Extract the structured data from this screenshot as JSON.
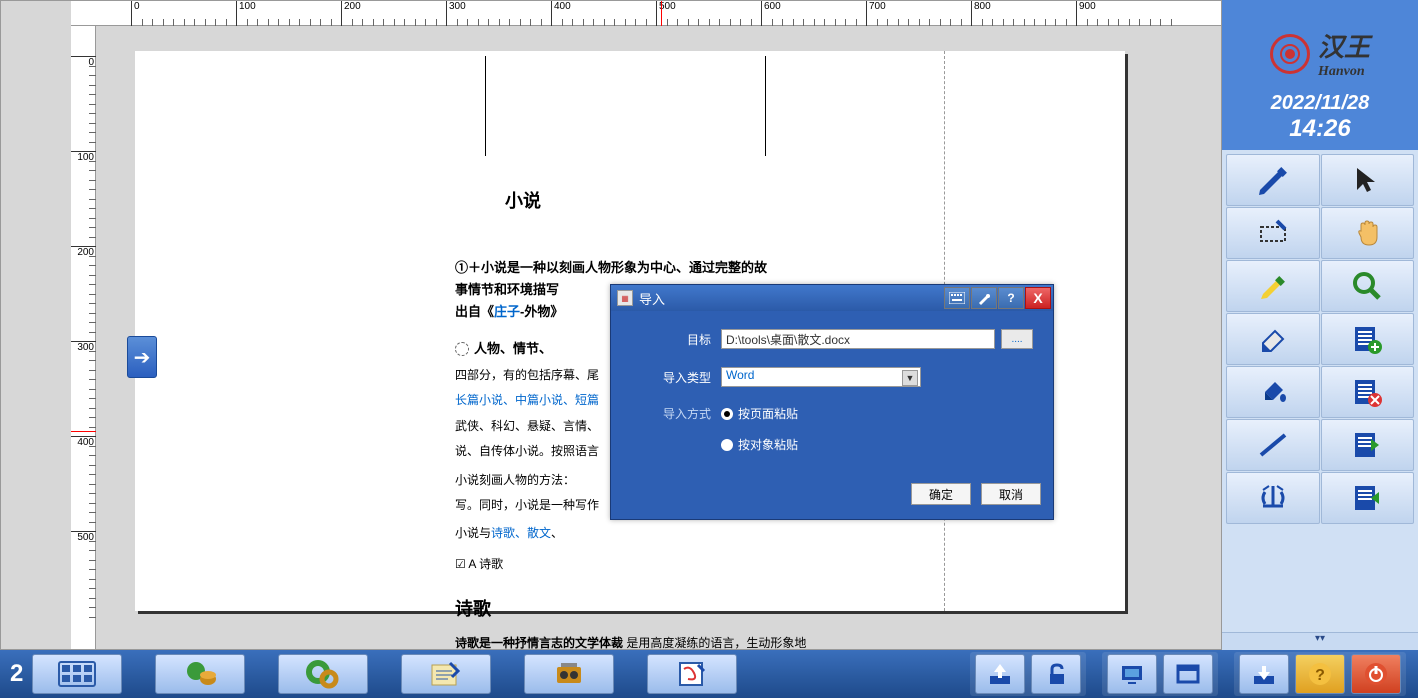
{
  "ruler_h": [
    "0",
    "100",
    "200",
    "300",
    "400",
    "500",
    "600",
    "700",
    "800",
    "900"
  ],
  "ruler_v": [
    "0",
    "100",
    "200",
    "300",
    "400",
    "500"
  ],
  "brand": {
    "cn": "汉王",
    "en": "Hanvon"
  },
  "date": "2022/11/28",
  "time": "14:26",
  "page_num": "2",
  "doc": {
    "title1": "小说",
    "line1a": "①＋小说是一种以刻画人物形象为中心、通过完整的故",
    "line1b": "事情节和环境描写",
    "line1c_pre": "出自《",
    "line1c_link": "庄子",
    "line1c_post": "-外物》",
    "line2_bold": "人物、情节、",
    "line2a": "四部分，有的包括序幕、尾",
    "line2b_link": "长篇小说、中篇小说、短篇",
    "line2c": "武侠、科幻、悬疑、言情、",
    "line2d": "说、自传体小说。按照语言",
    "line2e": "小说刻画人物的方法：",
    "line2f": "写。同时，小说是一种写作",
    "line3_pre": "小说与",
    "line3_link": "诗歌、散文",
    "line3_post": "、",
    "line3_checkbox": "☑ A 诗歌",
    "title2": "诗歌",
    "line4_bold": "诗歌是一种抒情言志的文学体裁",
    "line4_post": " 是用高度凝练的语言，生动形象地"
  },
  "dialog": {
    "title": "导入",
    "target_label": "目标",
    "target_value": "D:\\tools\\桌面\\散文.docx",
    "browse": "....",
    "type_label": "导入类型",
    "type_value": "Word",
    "method_label": "导入方式",
    "opt1": "按页面粘贴",
    "opt2": "按对象粘贴",
    "ok": "确定",
    "cancel": "取消",
    "help": "?",
    "close": "X"
  }
}
